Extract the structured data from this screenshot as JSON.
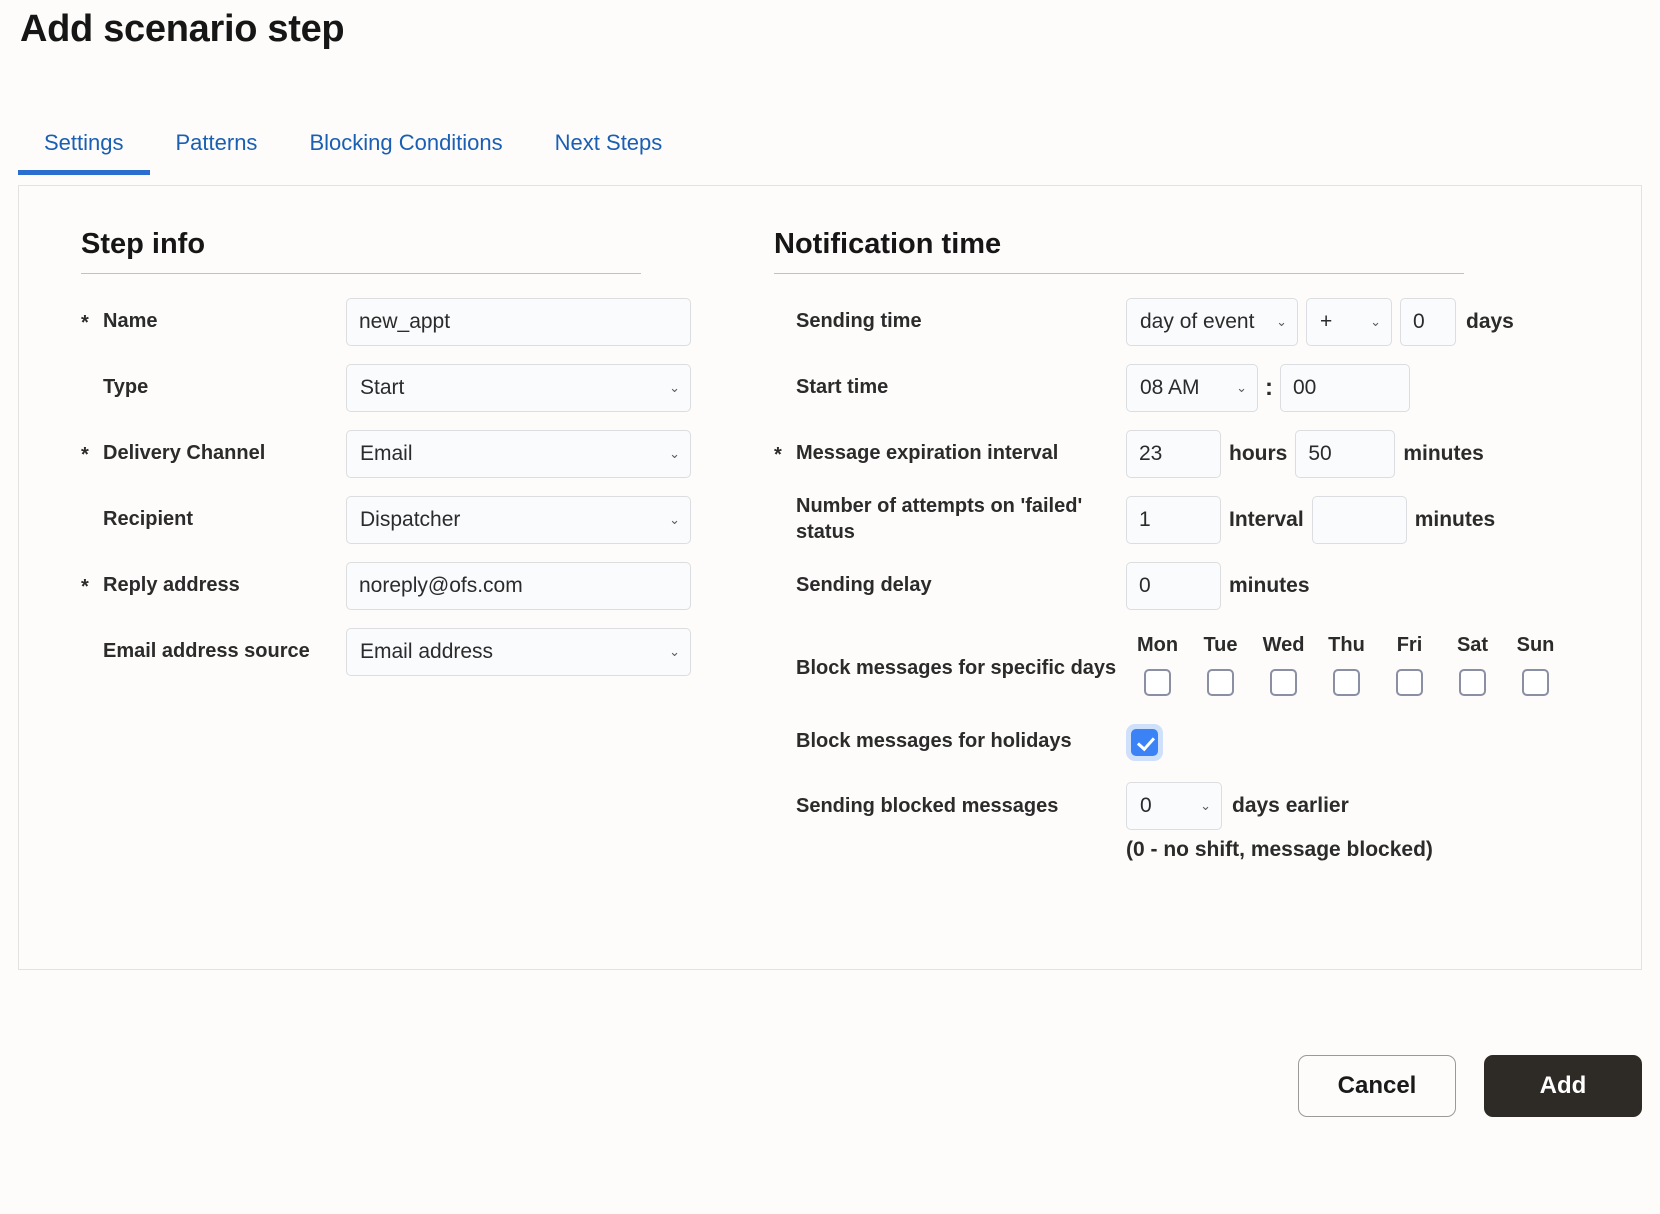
{
  "header": {
    "title": "Add scenario step"
  },
  "tabs": [
    {
      "label": "Settings",
      "active": true
    },
    {
      "label": "Patterns",
      "active": false
    },
    {
      "label": "Blocking Conditions",
      "active": false
    },
    {
      "label": "Next Steps",
      "active": false
    }
  ],
  "step_info": {
    "section_title": "Step info",
    "required_marker": "*",
    "name": {
      "label": "Name",
      "required": true,
      "value": "new_appt"
    },
    "type": {
      "label": "Type",
      "required": false,
      "value": "Start"
    },
    "delivery_channel": {
      "label": "Delivery Channel",
      "required": true,
      "value": "Email"
    },
    "recipient": {
      "label": "Recipient",
      "required": false,
      "value": "Dispatcher"
    },
    "reply_address": {
      "label": "Reply address",
      "required": true,
      "value": "noreply@ofs.com"
    },
    "email_address_source": {
      "label": "Email address source",
      "required": false,
      "value": "Email address"
    }
  },
  "notification_time": {
    "section_title": "Notification time",
    "required_marker": "*",
    "sending_time": {
      "label": "Sending time",
      "base": "day of event",
      "sign": "+",
      "offset": "0",
      "unit": "days"
    },
    "start_time": {
      "label": "Start time",
      "hour": "08 AM",
      "separator": ":",
      "minute": "00"
    },
    "message_expiration_interval": {
      "label": "Message expiration interval",
      "required": true,
      "hours": "23",
      "hours_unit": "hours",
      "minutes": "50",
      "minutes_unit": "minutes"
    },
    "attempts_failed": {
      "label": "Number of attempts on 'failed' status",
      "attempts": "1",
      "interval_label": "Interval",
      "interval_value": "",
      "interval_unit": "minutes"
    },
    "sending_delay": {
      "label": "Sending delay",
      "value": "0",
      "unit": "minutes"
    },
    "block_specific_days": {
      "label": "Block messages for specific days",
      "days": [
        {
          "name": "Mon",
          "checked": false
        },
        {
          "name": "Tue",
          "checked": false
        },
        {
          "name": "Wed",
          "checked": false
        },
        {
          "name": "Thu",
          "checked": false
        },
        {
          "name": "Fri",
          "checked": false
        },
        {
          "name": "Sat",
          "checked": false
        },
        {
          "name": "Sun",
          "checked": false
        }
      ]
    },
    "block_holidays": {
      "label": "Block messages for holidays",
      "checked": true,
      "focused": true
    },
    "sending_blocked_messages": {
      "label": "Sending blocked messages",
      "value": "0",
      "unit": "days earlier",
      "hint": "(0 - no shift, message blocked)"
    }
  },
  "footer": {
    "cancel_label": "Cancel",
    "add_label": "Add"
  },
  "colors": {
    "accent_blue": "#1a5fb4",
    "tab_underline": "#2a6fd0",
    "checkbox_checked": "#3b82f6",
    "focus_ring": "#cfe0fb",
    "primary_button_bg": "#2e2a26",
    "page_bg": "#fdfcfa"
  },
  "icons": {
    "chevron_down": "⌄"
  }
}
